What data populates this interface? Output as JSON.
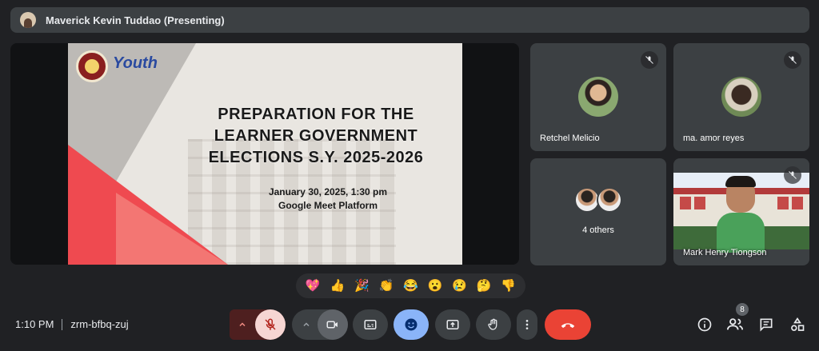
{
  "header": {
    "presenter_name": "Maverick Kevin Tuddao (Presenting)"
  },
  "slide": {
    "logo_text": "Youth",
    "title_lines": [
      "PREPARATION FOR THE",
      "LEARNER GOVERNMENT",
      "ELECTIONS S.Y. 2025-2026"
    ],
    "date_line": "January 30, 2025, 1:30 pm",
    "platform_line": "Google Meet Platform",
    "accent_color": "#ef4a50"
  },
  "participants": [
    {
      "name": "Retchel Melicio",
      "muted": true
    },
    {
      "name": "ma. amor reyes",
      "muted": true
    },
    {
      "name": "4 others"
    },
    {
      "name": "Mark Henry Tiongson",
      "muted": true
    }
  ],
  "reactions": [
    "💖",
    "👍",
    "🎉",
    "👏",
    "😂",
    "😮",
    "😢",
    "🤔",
    "👎"
  ],
  "meeting": {
    "time": "1:10 PM",
    "code": "zrm-bfbq-zuj"
  },
  "people_count": "8",
  "colors": {
    "end_call": "#ea4335",
    "active": "#8ab4f8",
    "background": "#202124",
    "tile": "#3c4043"
  },
  "icons": [
    "chevron-up-icon",
    "mic-off-icon",
    "camera-icon",
    "captions-icon",
    "emoji-icon",
    "present-icon",
    "raise-hand-icon",
    "more-vert-icon",
    "end-call-icon",
    "info-icon",
    "people-icon",
    "chat-icon",
    "activities-icon"
  ]
}
